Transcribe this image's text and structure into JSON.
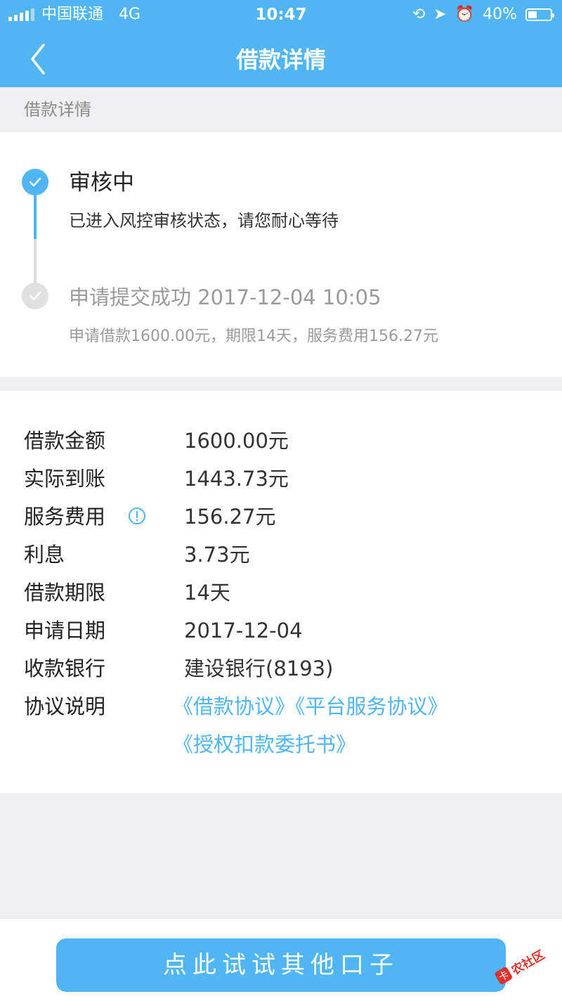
{
  "status_bar": {
    "carrier": "中国联通",
    "network": "4G",
    "time": "10:47",
    "battery": "40%",
    "battery_level": 0.4
  },
  "nav": {
    "title": "借款详情",
    "back_icon": "chevron-left-icon"
  },
  "section": {
    "label": "借款详情"
  },
  "timeline": {
    "step_current": {
      "title": "审核中",
      "desc": "已进入风控审核状态，请您耐心等待"
    },
    "step_done": {
      "title": "申请提交成功 2017-12-04 10:05",
      "desc": "申请借款1600.00元，期限14天，服务费用156.27元"
    }
  },
  "details": [
    {
      "label": "借款金额",
      "value": "1600.00元"
    },
    {
      "label": "实际到账",
      "value": "1443.73元"
    },
    {
      "label": "服务费用",
      "value": "156.27元"
    },
    {
      "label": "利息",
      "value": "3.73元"
    },
    {
      "label": "借款期限",
      "value": "14天"
    },
    {
      "label": "申请日期",
      "value": "2017-12-04"
    },
    {
      "label": "收款银行",
      "value": "建设银行(8193)"
    }
  ],
  "agreement": {
    "label": "协议说明",
    "links": [
      "《借款协议》",
      "《平台服务协议》",
      "《授权扣款委托书》"
    ]
  },
  "cta": {
    "label": "点此试试其他口子"
  },
  "watermark": {
    "text": "卡农社区"
  },
  "colors": {
    "accent": "#4fb6f3",
    "background": "#efeff1",
    "muted": "#9a9a9a"
  }
}
